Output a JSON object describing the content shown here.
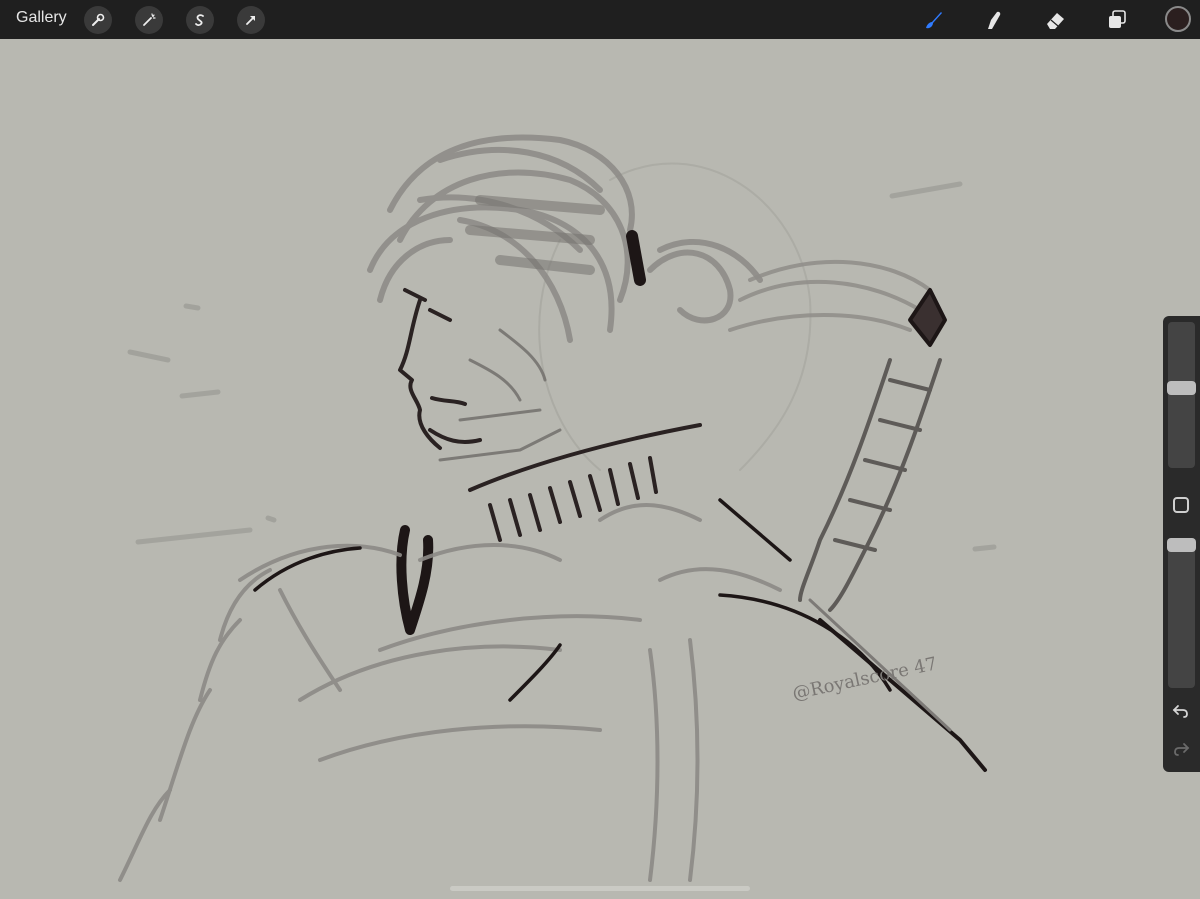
{
  "toolbar": {
    "gallery_label": "Gallery",
    "left_tools": [
      {
        "name": "actions",
        "icon": "wrench-icon"
      },
      {
        "name": "adjustments",
        "icon": "magic-wand-icon"
      },
      {
        "name": "selection",
        "icon": "selection-s-icon"
      },
      {
        "name": "transform",
        "icon": "arrow-cursor-icon"
      }
    ],
    "right_tools": [
      {
        "name": "brush",
        "icon": "brush-icon",
        "active": true
      },
      {
        "name": "smudge",
        "icon": "smudge-finger-icon",
        "active": false
      },
      {
        "name": "eraser",
        "icon": "eraser-icon",
        "active": false
      },
      {
        "name": "layers",
        "icon": "layers-icon",
        "active": false
      }
    ],
    "current_color": "#2b1f1f",
    "active_color": "#2f7bff"
  },
  "canvas": {
    "background_color": "#b8b8b1",
    "signature_text": "@Royalscore 47"
  },
  "sidebar": {
    "brush_size_level": 0.55,
    "brush_opacity_level": 1.0,
    "modify_icon": "square-icon",
    "undo_icon": "undo-arrow-icon",
    "redo_icon": "redo-arrow-icon"
  }
}
